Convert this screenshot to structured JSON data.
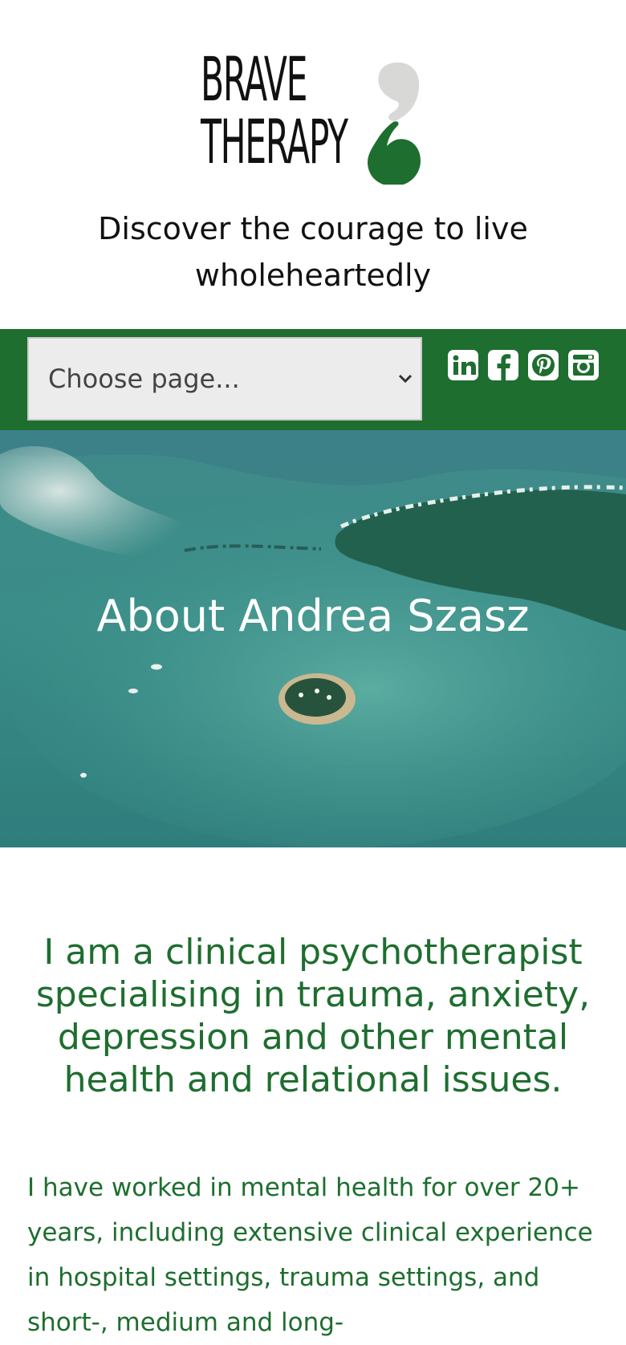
{
  "brand": {
    "logo_line1": "BRAVE",
    "logo_line2": "THERAPY"
  },
  "tagline": "Discover the courage to live wholeheartedly",
  "nav": {
    "select_label": "Choose page...",
    "social": [
      "linkedin-icon",
      "facebook-icon",
      "pinterest-icon",
      "instagram-icon"
    ]
  },
  "hero": {
    "title": "About Andrea Szasz"
  },
  "content": {
    "intro": "I am a clinical psychotherapist specialising in trauma, anxiety, depression and  other mental health and relational issues.",
    "bio": "I have worked in mental health for over 20+ years, including extensive clinical experience in hospital settings, trauma settings, and short-, medium and long-"
  },
  "colors": {
    "brand_green": "#1e6e2f",
    "select_bg": "#ececec",
    "comma_grey": "#d8d8d6"
  }
}
